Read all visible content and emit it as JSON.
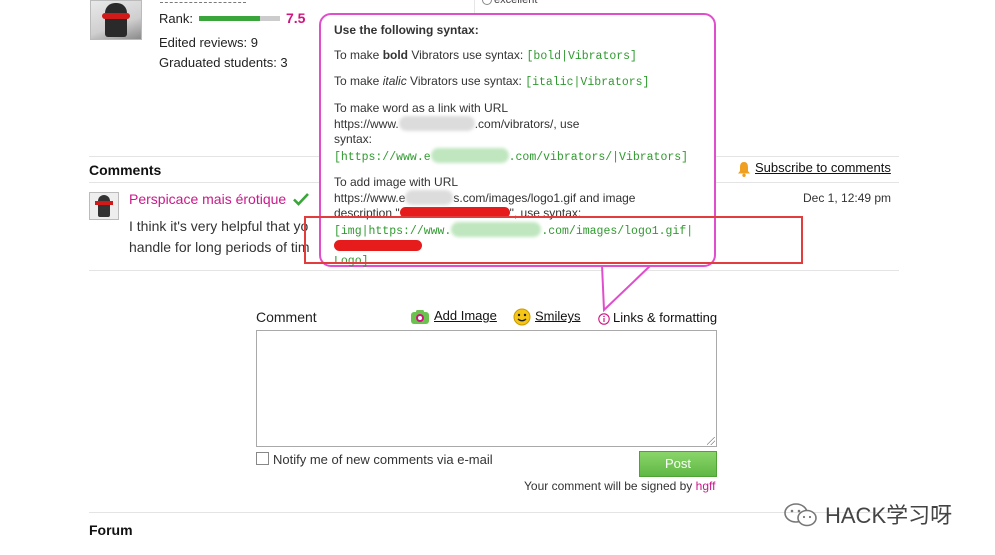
{
  "profile": {
    "rank_label": "Rank:",
    "rank_value": "7.5",
    "rank_fraction": 0.75,
    "edited_reviews": "Edited reviews: 9",
    "graduated_students": "Graduated students: 3",
    "rating_option": "excellent"
  },
  "comments": {
    "title": "Comments",
    "subscribe": "Subscribe to comments",
    "items": [
      {
        "author": "Perspicace mais érotique",
        "date": "Dec 1, 12:49 pm",
        "text": "I think it's very helpful that yo handle for long periods of tim"
      }
    ]
  },
  "tooltip": {
    "heading": "Use the following syntax:",
    "bold_pre": "To make ",
    "bold_word": "bold",
    "bold_post": " Vibrators use syntax:",
    "bold_code": "[bold|Vibrators]",
    "italic_pre": "To make ",
    "italic_word": "italic",
    "italic_post": " Vibrators use syntax:",
    "italic_code": "[italic|Vibrators]",
    "link_line1": "To make word as a link with URL",
    "link_line2_pre": "https://www.",
    "link_line2_post": ".com/vibrators/, use",
    "link_line3": "syntax:",
    "link_code_pre": "[https://www.e",
    "link_code_post": ".com/vibrators/|Vibrators]",
    "img_line1": "To add image with URL",
    "img_line2_pre": "https://www.e",
    "img_line2_post": "s.com/images/logo1.gif and image",
    "img_line3_pre": "description \"",
    "img_line3_post": "\", use syntax:",
    "img_code_pre": "[img|https://www.",
    "img_code_post": ".com/images/logo1.gif|",
    "img_code_line2": "Logo]"
  },
  "form": {
    "label": "Comment",
    "add_image": "Add Image",
    "smileys": "Smileys",
    "links_formatting": "Links & formatting",
    "notify": "Notify me of new comments via e-mail",
    "post": "Post",
    "signed_pre": "Your comment will be signed by ",
    "signed_user": "hgff"
  },
  "forum": {
    "title": "Forum"
  },
  "watermark": {
    "text": "HACK学习呀"
  },
  "colors": {
    "accent_pink": "#c8198a",
    "rank_bar": "#3aa53a",
    "tooltip_border": "#e14ecd",
    "highlight_box": "#e23d3d",
    "code_green": "#2f9a2f",
    "post_button": "#6cc24f"
  }
}
